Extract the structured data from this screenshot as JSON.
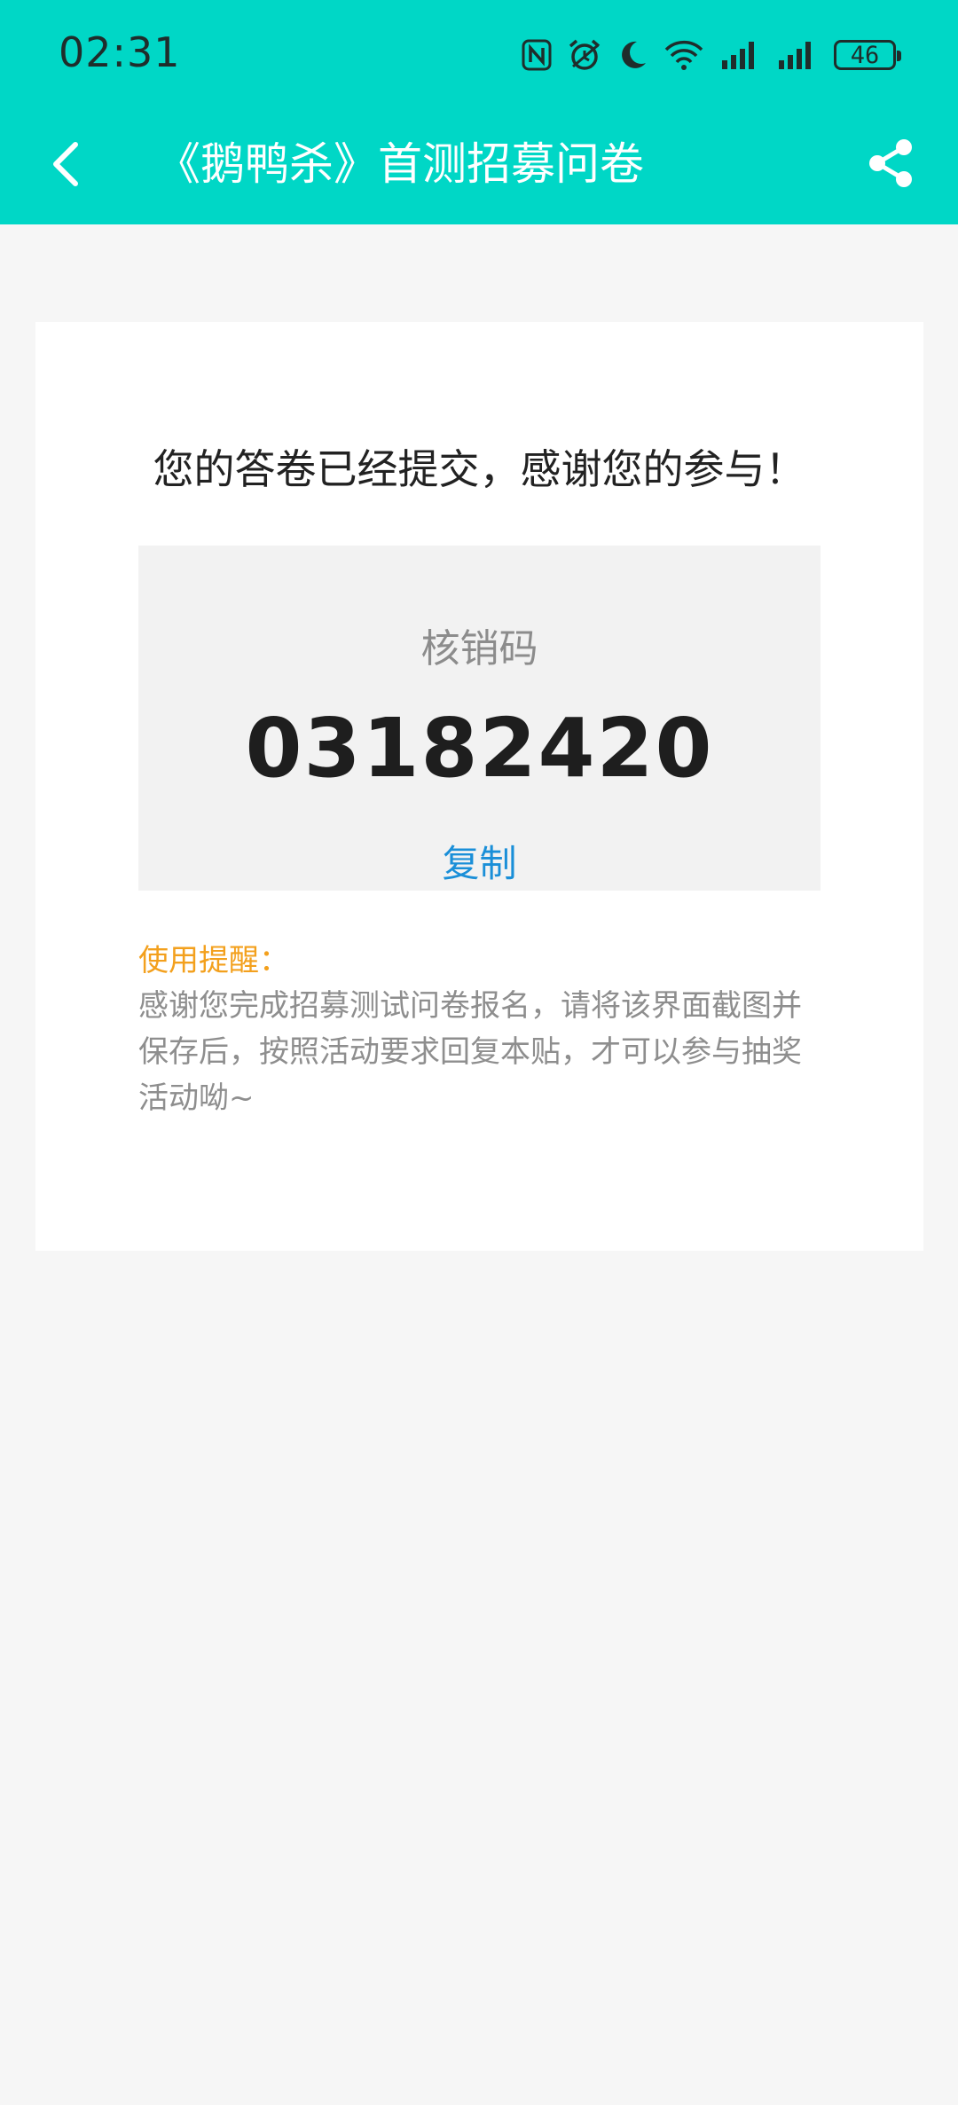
{
  "status_bar": {
    "time": "02:31",
    "battery": "46",
    "icons": [
      "nfc-icon",
      "alarm-icon",
      "moon-icon",
      "wifi-icon",
      "signal-icon",
      "signal-icon",
      "battery-icon"
    ]
  },
  "nav": {
    "title": "《鹅鸭杀》首测招募问卷",
    "back_icon": "chevron-left-icon",
    "share_icon": "share-icon"
  },
  "result": {
    "message": "您的答卷已经提交，感谢您的参与！",
    "code_label": "核销码",
    "code": "03182420",
    "copy_label": "复制"
  },
  "tip": {
    "title": "使用提醒：",
    "body": "感谢您完成招募测试问卷报名，请将该界面截图并保存后，按照活动要求回复本贴，才可以参与抽奖活动呦~"
  },
  "colors": {
    "header_bg": "#00d7c6",
    "page_bg": "#f6f6f6",
    "card_bg": "#ffffff",
    "code_box_bg": "#f2f2f2",
    "link": "#1a8fd8",
    "tip_title": "#f3a01d"
  }
}
